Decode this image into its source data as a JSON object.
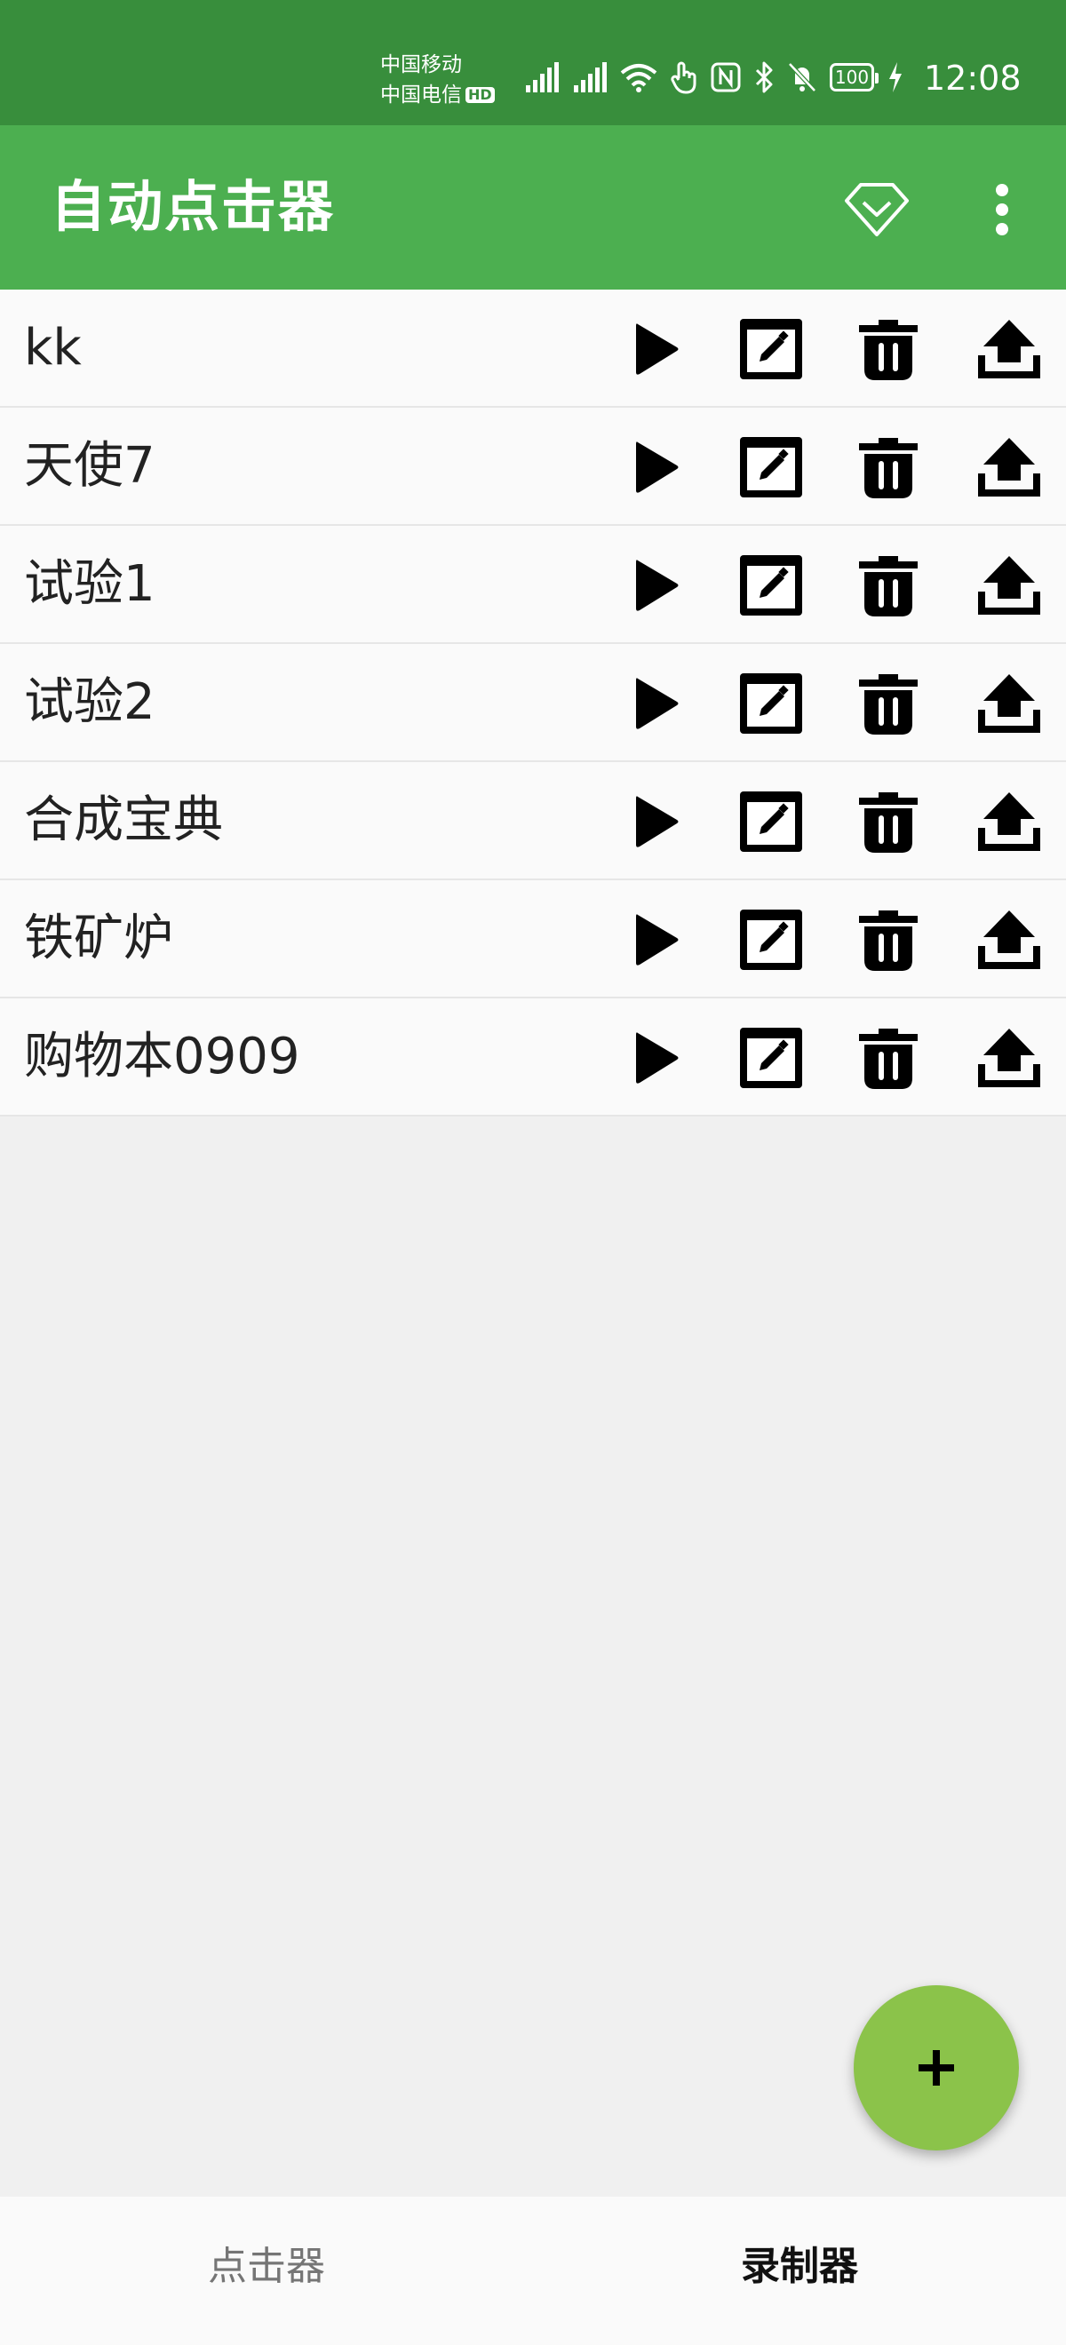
{
  "status_bar": {
    "carrier_1": "中国移动",
    "carrier_2": "中国电信",
    "hd_badge": "HD",
    "battery": "100",
    "time": "12:08",
    "icons": [
      "signal-icon",
      "signal-icon",
      "wifi-icon",
      "touch-icon",
      "nfc-icon",
      "bluetooth-icon",
      "bell-off-icon",
      "battery-icon",
      "charging-icon"
    ]
  },
  "app_bar": {
    "title": "自动点击器",
    "icons": [
      "gem-icon",
      "more-vert-icon"
    ]
  },
  "list": {
    "items": [
      {
        "name": "kk"
      },
      {
        "name": "天使7"
      },
      {
        "name": "试验1"
      },
      {
        "name": "试验2"
      },
      {
        "name": "合成宝典"
      },
      {
        "name": "铁矿炉"
      },
      {
        "name": "购物本0909"
      }
    ],
    "row_actions": [
      "play-icon",
      "edit-icon",
      "delete-icon",
      "upload-icon"
    ]
  },
  "fab": {
    "icon": "plus-icon"
  },
  "bottom_nav": {
    "tabs": [
      {
        "label": "点击器",
        "active": false
      },
      {
        "label": "录制器",
        "active": true
      }
    ]
  },
  "colors": {
    "status_bar": "#388e3c",
    "app_bar": "#4caf50",
    "fab": "#8bc34a",
    "background": "#f0f0f0"
  }
}
